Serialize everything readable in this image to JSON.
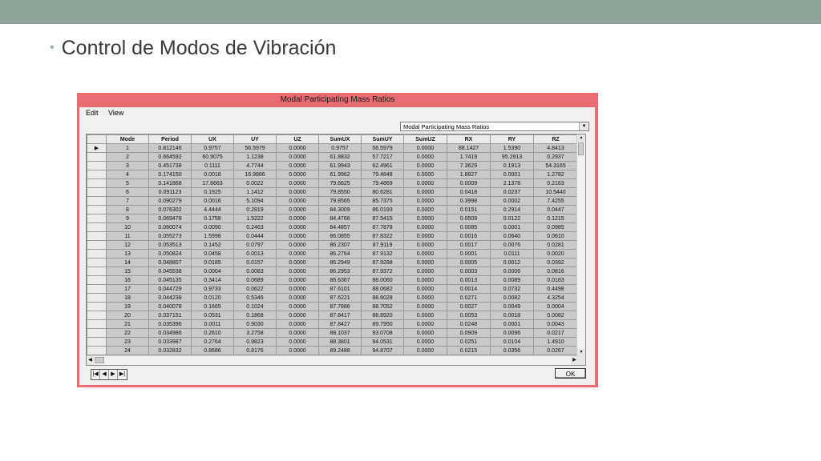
{
  "slide": {
    "bullet": "•",
    "title": "Control de Modos de Vibración"
  },
  "window": {
    "title": "Modal Participating Mass Ratios",
    "menu": [
      "Edit",
      "View"
    ],
    "dropdown_value": "Modal Participating Mass Ratios",
    "ok_label": "OK",
    "current_row_marker": "▶",
    "nav_icons": [
      "first-icon",
      "prev-icon",
      "next-icon",
      "last-icon"
    ]
  },
  "table": {
    "columns": [
      "Mode",
      "Period",
      "UX",
      "UY",
      "UZ",
      "SumUX",
      "SumUY",
      "SumUZ",
      "RX",
      "RY",
      "RZ"
    ],
    "rows": [
      [
        "1",
        "0.812146",
        "0.9757",
        "56.5979",
        "0.0000",
        "0.9757",
        "56.5979",
        "0.0000",
        "88.1427",
        "1.5390",
        "4.8413"
      ],
      [
        "2",
        "0.664592",
        "60.9075",
        "1.1238",
        "0.0000",
        "61.8832",
        "57.7217",
        "0.0000",
        "1.7419",
        "95.2913",
        "0.2937"
      ],
      [
        "3",
        "0.451738",
        "0.1111",
        "4.7744",
        "0.0000",
        "61.9943",
        "62.4961",
        "0.0000",
        "7.3629",
        "0.1913",
        "54.3165"
      ],
      [
        "4",
        "0.174150",
        "0.0018",
        "16.9886",
        "0.0000",
        "61.9962",
        "79.4848",
        "0.0000",
        "1.8827",
        "0.0001",
        "1.2782"
      ],
      [
        "5",
        "0.141868",
        "17.6663",
        "0.0022",
        "0.0000",
        "79.6625",
        "79.4869",
        "0.0000",
        "0.0009",
        "2.1378",
        "0.2163"
      ],
      [
        "6",
        "0.091123",
        "0.1925",
        "1.1412",
        "0.0000",
        "79.8550",
        "80.6281",
        "0.0000",
        "0.0418",
        "0.0237",
        "10.5440"
      ],
      [
        "7",
        "0.090279",
        "0.0016",
        "5.1094",
        "0.0000",
        "79.8565",
        "85.7375",
        "0.0000",
        "0.3998",
        "0.0002",
        "7.4255"
      ],
      [
        "8",
        "0.076302",
        "4.4444",
        "0.2819",
        "0.0000",
        "84.3009",
        "86.0193",
        "0.0000",
        "0.0151",
        "0.2914",
        "0.0447"
      ],
      [
        "9",
        "0.069478",
        "0.1758",
        "1.5222",
        "0.0000",
        "84.4766",
        "87.5415",
        "0.0000",
        "0.0509",
        "0.0122",
        "0.1215"
      ],
      [
        "10",
        "0.060074",
        "0.0090",
        "0.2463",
        "0.0000",
        "84.4857",
        "87.7878",
        "0.0000",
        "0.0085",
        "0.0001",
        "0.0985"
      ],
      [
        "11",
        "0.055273",
        "1.5998",
        "0.0444",
        "0.0000",
        "86.0855",
        "87.8322",
        "0.0000",
        "0.0016",
        "0.0640",
        "0.0610"
      ],
      [
        "12",
        "0.053513",
        "0.1452",
        "0.0797",
        "0.0000",
        "86.2307",
        "87.9119",
        "0.0000",
        "0.0017",
        "0.0076",
        "0.0281"
      ],
      [
        "13",
        "0.050824",
        "0.0458",
        "0.0013",
        "0.0000",
        "86.2764",
        "87.9132",
        "0.0000",
        "0.0001",
        "0.0111",
        "0.0020"
      ],
      [
        "14",
        "0.048807",
        "0.0185",
        "0.0157",
        "0.0000",
        "86.2949",
        "87.9288",
        "0.0000",
        "0.0005",
        "0.0012",
        "0.0392"
      ],
      [
        "15",
        "0.045538",
        "0.0004",
        "0.0083",
        "0.0000",
        "86.2953",
        "87.9372",
        "0.0000",
        "0.0003",
        "0.0006",
        "0.0816"
      ],
      [
        "16",
        "0.045135",
        "0.3414",
        "0.0689",
        "0.0000",
        "86.6367",
        "88.0060",
        "0.0000",
        "0.0013",
        "0.0089",
        "0.0183"
      ],
      [
        "17",
        "0.044729",
        "0.9733",
        "0.0622",
        "0.0000",
        "87.6101",
        "88.0682",
        "0.0000",
        "0.0014",
        "0.0732",
        "0.4498"
      ],
      [
        "18",
        "0.044238",
        "0.0120",
        "0.5346",
        "0.0000",
        "87.6221",
        "88.6028",
        "0.0000",
        "0.0271",
        "0.0082",
        "4.3254"
      ],
      [
        "19",
        "0.040078",
        "0.1665",
        "0.1024",
        "0.0000",
        "87.7886",
        "88.7052",
        "0.0000",
        "0.0027",
        "0.0049",
        "0.0004"
      ],
      [
        "20",
        "0.037151",
        "0.0531",
        "0.1868",
        "0.0000",
        "87.8417",
        "88.8920",
        "0.0000",
        "0.0053",
        "0.0018",
        "0.0082"
      ],
      [
        "21",
        "0.035396",
        "0.0011",
        "0.9030",
        "0.0000",
        "87.8427",
        "89.7950",
        "0.0000",
        "0.0248",
        "0.0001",
        "0.0043"
      ],
      [
        "22",
        "0.034986",
        "0.2610",
        "3.2758",
        "0.0000",
        "88.1037",
        "93.0708",
        "0.0000",
        "0.0909",
        "0.0096",
        "0.0217"
      ],
      [
        "23",
        "0.033987",
        "0.2764",
        "0.9823",
        "0.0000",
        "88.3801",
        "94.0531",
        "0.0000",
        "0.0251",
        "0.0104",
        "1.4910"
      ],
      [
        "24",
        "0.032832",
        "0.8686",
        "0.8176",
        "0.0000",
        "89.2488",
        "94.8707",
        "0.0000",
        "0.0215",
        "0.0356",
        "0.0267"
      ]
    ]
  },
  "colors": {
    "topbar": "#8fa39a",
    "window_frame": "#e86c72",
    "cell_background": "#c9c9c9"
  }
}
